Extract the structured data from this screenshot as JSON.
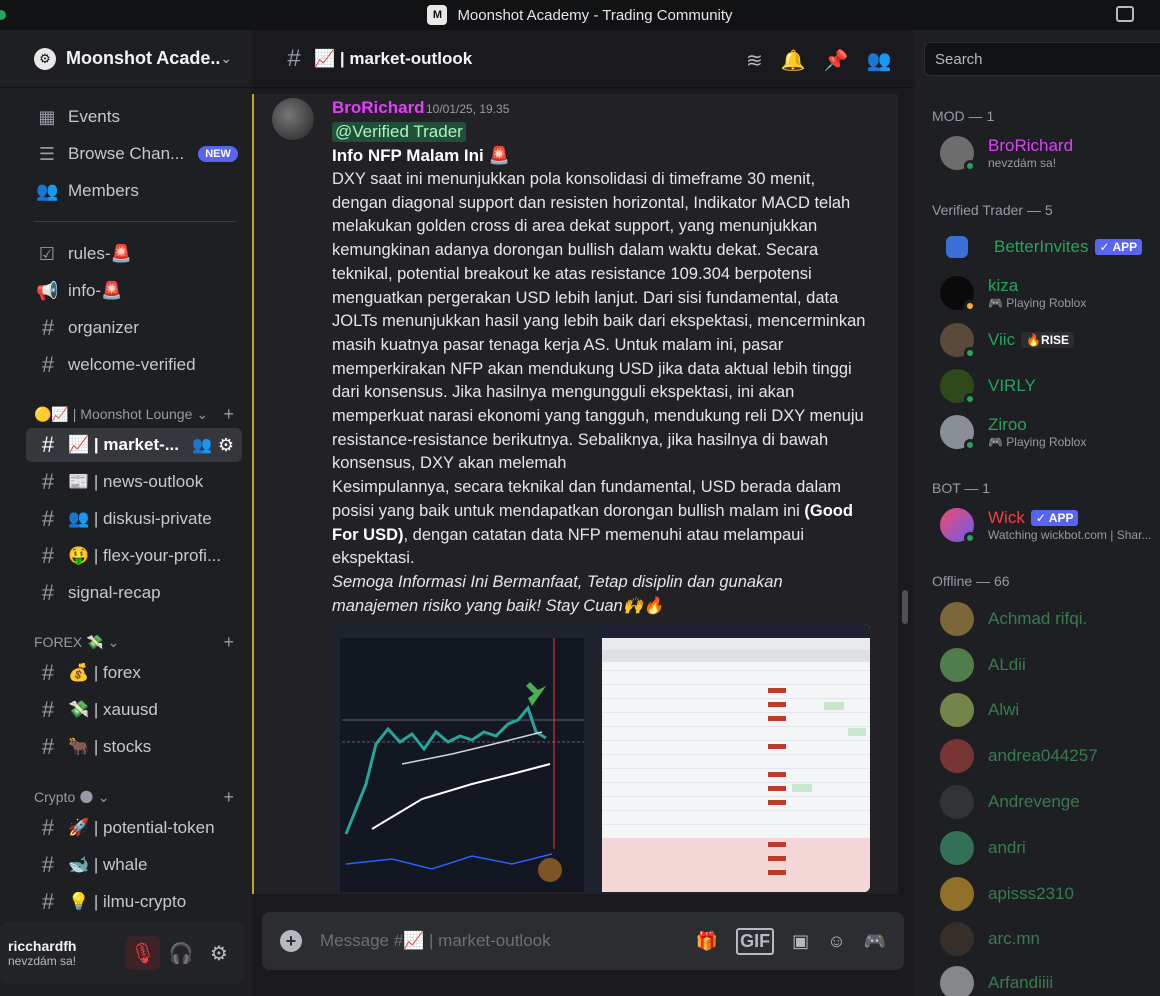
{
  "window": {
    "title": "Moonshot Academy - Trading Community"
  },
  "guild": {
    "name": "Moonshot Acade..."
  },
  "sidebar": {
    "top_items": [
      {
        "icon": "calendar-icon",
        "label": "Events"
      },
      {
        "icon": "browse-channels-icon",
        "label": "Browse Chan...",
        "badge": "NEW"
      },
      {
        "icon": "members-icon",
        "label": "Members"
      }
    ],
    "channels_top": [
      {
        "label": "rules-🚨"
      },
      {
        "label": "info-🚨"
      },
      {
        "label": "organizer"
      },
      {
        "label": "welcome-verified"
      }
    ],
    "category_lounge": "🟡📈 | Moonshot Lounge",
    "lounge_channels": [
      {
        "label": "📈 | market-..."
      },
      {
        "label": "📰 | news-outlook"
      },
      {
        "label": "👥 | diskusi-private"
      },
      {
        "label": "🤑 | flex-your-profi..."
      },
      {
        "label": "signal-recap"
      }
    ],
    "category_forex": "FOREX 💸",
    "forex_channels": [
      {
        "label": "💰 | forex"
      },
      {
        "label": "💸 | xauusd"
      },
      {
        "label": "🐂 | stocks"
      }
    ],
    "category_crypto": "Crypto 🌑",
    "crypto_channels": [
      {
        "label": "🚀 | potential-token"
      },
      {
        "label": "🐋 | whale"
      },
      {
        "label": "💡 | ilmu-crypto"
      }
    ]
  },
  "user_panel": {
    "name": "ricchardfh",
    "status": "nevzdám sa!"
  },
  "channel": {
    "name": "📈 | market-outlook"
  },
  "search": {
    "placeholder": "Search"
  },
  "message": {
    "author": "BroRichard",
    "timestamp": "10/01/25, 19.35",
    "mention": "@Verified Trader",
    "title": "Info NFP Malam Ini 🚨",
    "paragraph1": "DXY saat ini menunjukkan pola konsolidasi di timeframe 30 menit, dengan diagonal support dan resisten horizontal, Indikator MACD telah melakukan golden cross di area dekat support, yang menunjukkan kemungkinan adanya dorongan bullish dalam waktu dekat. Secara teknikal, potential breakout ke atas resistance 109.304 berpotensi menguatkan pergerakan USD lebih lanjut. Dari sisi fundamental, data JOLTs menunjukkan hasil yang lebih baik dari ekspektasi, mencerminkan masih kuatnya pasar tenaga kerja AS. Untuk malam ini, pasar memperkirakan NFP akan mendukung USD jika data aktual lebih tinggi dari konsensus. Jika hasilnya mengungguli ekspektasi, ini akan memperkuat narasi ekonomi yang tangguh, mendukung reli DXY menuju resistance-resistance berikutnya. Sebaliknya, jika hasilnya di bawah konsensus, DXY akan melemah",
    "paragraph2_start": "Kesimpulannya, secara teknikal dan fundamental, USD berada dalam posisi yang baik untuk mendapatkan dorongan bullish malam ini ",
    "paragraph2_bold": "(Good For USD)",
    "paragraph2_end": ", dengan catatan data NFP memenuhi atau melampaui ekspektasi.",
    "closing": "Semoga Informasi Ini Bermanfaat, Tetap disiplin dan gunakan manajemen risiko yang baik! Stay Cuan🙌🔥"
  },
  "composer": {
    "placeholder": "Message #📈 | market-outlook",
    "gif": "GIF"
  },
  "member_list": {
    "mod_header": "MOD — 1",
    "mods": [
      {
        "name": "BroRichard",
        "sub": "nevzdám sa!",
        "color": "#e040fb"
      }
    ],
    "verified_header": "Verified Trader — 5",
    "verified": [
      {
        "name": "BetterInvites",
        "badge": "✓ APP"
      },
      {
        "name": "kiza",
        "sub": "🎮 Playing Roblox"
      },
      {
        "name": "Viic",
        "badge": "🔥RISE"
      },
      {
        "name": "VIRLY"
      },
      {
        "name": "Ziroo",
        "sub": "🎮 Playing Roblox"
      }
    ],
    "bot_header": "BOT — 1",
    "bots": [
      {
        "name": "Wick",
        "badge": "✓ APP",
        "sub": "Watching wickbot.com | Shar...",
        "color": "#f23f43"
      }
    ],
    "offline_header": "Offline — 66",
    "offline": [
      "Achmad rifqi.",
      "ALdii",
      "Alwi",
      "andrea044257",
      "Andrevenge",
      "andri",
      "apisss2310",
      "arc.mn",
      "Arfandiiii"
    ]
  }
}
